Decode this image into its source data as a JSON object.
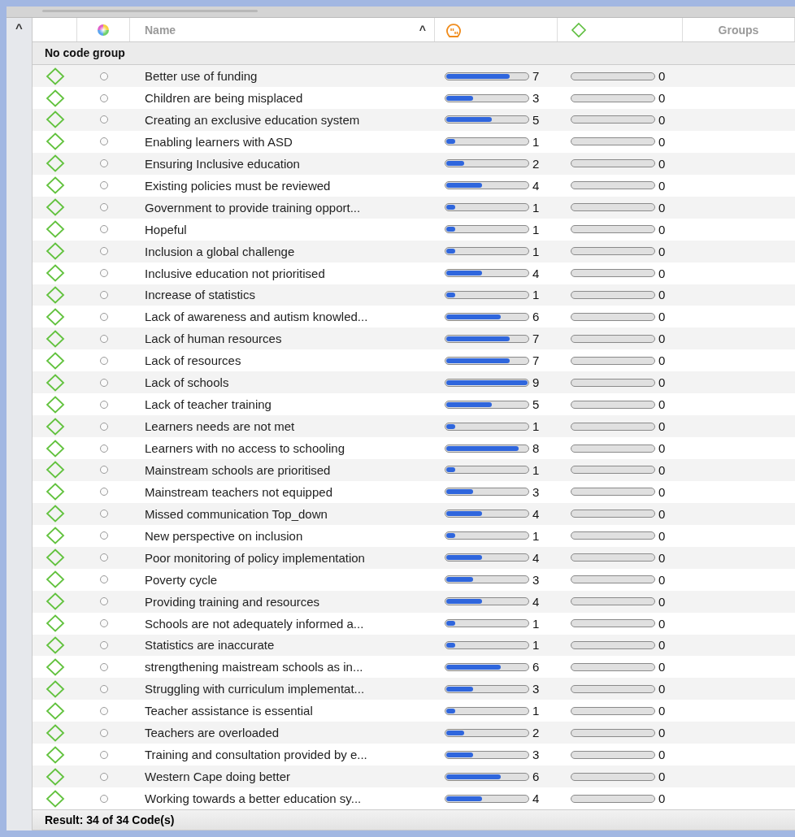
{
  "table": {
    "gutter_toggle": "^",
    "columns": [
      {
        "kind": "blank"
      },
      {
        "kind": "color-icon"
      },
      {
        "kind": "text",
        "label": "Name",
        "sort_indicator": "^"
      },
      {
        "kind": "quote-icon"
      },
      {
        "kind": "code-icon"
      },
      {
        "kind": "text",
        "label": "Groups"
      }
    ],
    "group": "No code group",
    "rows": [
      {
        "name": "Better use of funding",
        "bars": [
          {
            "count": "7",
            "level": 0.78
          },
          {
            "count": "0"
          }
        ]
      },
      {
        "name": "Children are being misplaced",
        "bars": [
          {
            "count": "3",
            "level": 0.33
          },
          {
            "count": "0"
          }
        ]
      },
      {
        "name": "Creating an exclusive education system",
        "bars": [
          {
            "count": "5",
            "level": 0.56
          },
          {
            "count": "0"
          }
        ]
      },
      {
        "name": "Enabling learners with ASD",
        "bars": [
          {
            "count": "1",
            "level": 0.11
          },
          {
            "count": "0"
          }
        ]
      },
      {
        "name": "Ensuring Inclusive education",
        "bars": [
          {
            "count": "2",
            "level": 0.22
          },
          {
            "count": "0"
          }
        ]
      },
      {
        "name": "Existing policies must be reviewed",
        "bars": [
          {
            "count": "4",
            "level": 0.44
          },
          {
            "count": "0"
          }
        ]
      },
      {
        "name": "Government to provide training opport...",
        "bars": [
          {
            "count": "1",
            "level": 0.11
          },
          {
            "count": "0"
          }
        ]
      },
      {
        "name": "Hopeful",
        "bars": [
          {
            "count": "1",
            "level": 0.11
          },
          {
            "count": "0"
          }
        ]
      },
      {
        "name": "Inclusion a global challenge",
        "bars": [
          {
            "count": "1",
            "level": 0.11
          },
          {
            "count": "0"
          }
        ]
      },
      {
        "name": "Inclusive education not prioritised",
        "bars": [
          {
            "count": "4",
            "level": 0.44
          },
          {
            "count": "0"
          }
        ]
      },
      {
        "name": "Increase of statistics",
        "bars": [
          {
            "count": "1",
            "level": 0.11
          },
          {
            "count": "0"
          }
        ]
      },
      {
        "name": "Lack of awareness and autism knowled...",
        "bars": [
          {
            "count": "6",
            "level": 0.67
          },
          {
            "count": "0"
          }
        ]
      },
      {
        "name": "Lack of human resources",
        "bars": [
          {
            "count": "7",
            "level": 0.78
          },
          {
            "count": "0"
          }
        ]
      },
      {
        "name": "Lack of resources",
        "bars": [
          {
            "count": "7",
            "level": 0.78
          },
          {
            "count": "0"
          }
        ]
      },
      {
        "name": "Lack of schools",
        "bars": [
          {
            "count": "9",
            "level": 1
          },
          {
            "count": "0"
          }
        ]
      },
      {
        "name": "Lack of teacher training",
        "bars": [
          {
            "count": "5",
            "level": 0.56
          },
          {
            "count": "0"
          }
        ]
      },
      {
        "name": "Learners needs are not met",
        "bars": [
          {
            "count": "1",
            "level": 0.11
          },
          {
            "count": "0"
          }
        ]
      },
      {
        "name": "Learners with no access to schooling",
        "bars": [
          {
            "count": "8",
            "level": 0.89
          },
          {
            "count": "0"
          }
        ]
      },
      {
        "name": "Mainstream schools are prioritised",
        "bars": [
          {
            "count": "1",
            "level": 0.11
          },
          {
            "count": "0"
          }
        ]
      },
      {
        "name": "Mainstream teachers not equipped",
        "bars": [
          {
            "count": "3",
            "level": 0.33
          },
          {
            "count": "0"
          }
        ]
      },
      {
        "name": "Missed communication Top_down",
        "bars": [
          {
            "count": "4",
            "level": 0.44
          },
          {
            "count": "0"
          }
        ]
      },
      {
        "name": "New perspective on inclusion",
        "bars": [
          {
            "count": "1",
            "level": 0.11
          },
          {
            "count": "0"
          }
        ]
      },
      {
        "name": "Poor monitoring of policy implementation",
        "bars": [
          {
            "count": "4",
            "level": 0.44
          },
          {
            "count": "0"
          }
        ]
      },
      {
        "name": "Poverty cycle",
        "bars": [
          {
            "count": "3",
            "level": 0.33
          },
          {
            "count": "0"
          }
        ]
      },
      {
        "name": "Providing training and resources",
        "bars": [
          {
            "count": "4",
            "level": 0.44
          },
          {
            "count": "0"
          }
        ]
      },
      {
        "name": "Schools are not adequately informed a...",
        "bars": [
          {
            "count": "1",
            "level": 0.11
          },
          {
            "count": "0"
          }
        ]
      },
      {
        "name": "Statistics are inaccurate",
        "bars": [
          {
            "count": "1",
            "level": 0.11
          },
          {
            "count": "0"
          }
        ]
      },
      {
        "name": "strengthening maistream schools as in...",
        "bars": [
          {
            "count": "6",
            "level": 0.67
          },
          {
            "count": "0"
          }
        ]
      },
      {
        "name": "Struggling with curriculum implementat...",
        "bars": [
          {
            "count": "3",
            "level": 0.33
          },
          {
            "count": "0"
          }
        ]
      },
      {
        "name": "Teacher assistance is essential",
        "bars": [
          {
            "count": "1",
            "level": 0.11
          },
          {
            "count": "0"
          }
        ]
      },
      {
        "name": "Teachers are overloaded",
        "bars": [
          {
            "count": "2",
            "level": 0.22
          },
          {
            "count": "0"
          }
        ]
      },
      {
        "name": "Training and consultation provided by e...",
        "bars": [
          {
            "count": "3",
            "level": 0.33
          },
          {
            "count": "0"
          }
        ]
      },
      {
        "name": "Western Cape doing better",
        "bars": [
          {
            "count": "6",
            "level": 0.67
          },
          {
            "count": "0"
          }
        ]
      },
      {
        "name": "Working towards a better education sy...",
        "bars": [
          {
            "count": "4",
            "level": 0.44
          },
          {
            "count": "0"
          }
        ]
      }
    ]
  },
  "status_bar": "Result: 34 of 34 Code(s)"
}
